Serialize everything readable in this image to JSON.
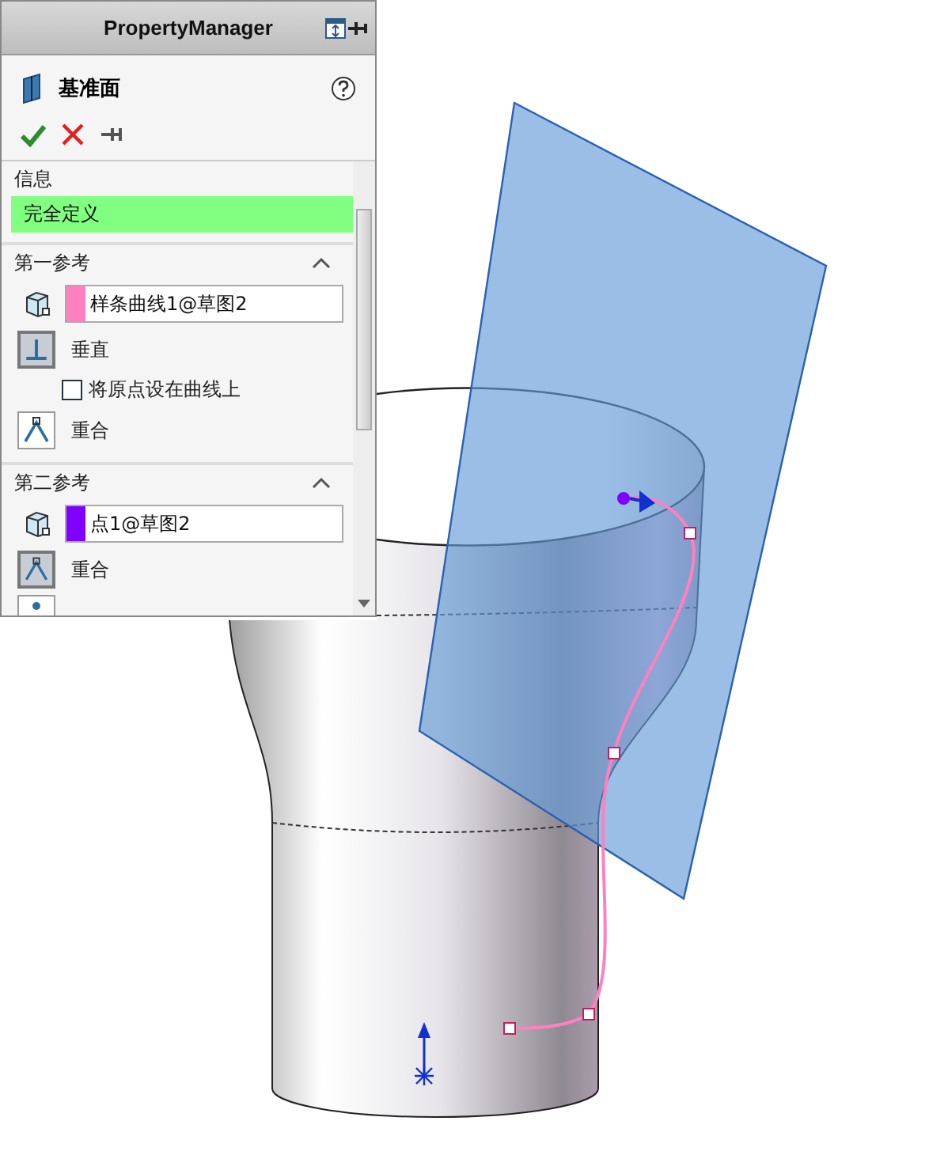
{
  "panel": {
    "title": "PropertyManager",
    "feature": {
      "title": "基准面"
    },
    "info": {
      "heading": "信息",
      "message": "完全定义"
    },
    "references": [
      {
        "heading": "第一参考",
        "expanded": true,
        "selection": {
          "text": "样条曲线1@草图2",
          "color": "#ff80c0"
        },
        "options": [
          {
            "kind": "perpendicular",
            "label": "垂直",
            "selected": true
          },
          {
            "kind": "checkbox",
            "label": "将原点设在曲线上",
            "checked": false
          },
          {
            "kind": "coincident",
            "label": "重合",
            "selected": false
          }
        ]
      },
      {
        "heading": "第二参考",
        "expanded": true,
        "selection": {
          "text": "点1@草图2",
          "color": "#8000ff"
        },
        "options": [
          {
            "kind": "coincident",
            "label": "重合",
            "selected": true
          }
        ]
      }
    ]
  }
}
